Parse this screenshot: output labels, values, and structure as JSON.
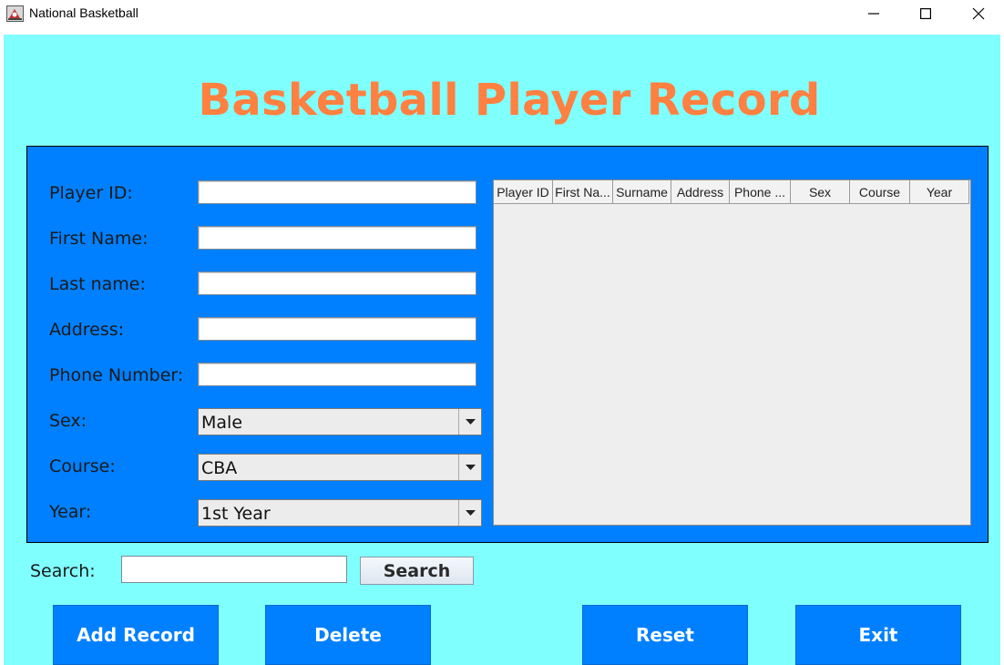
{
  "window": {
    "title": "National Basketball",
    "app_icon": "java-duke-icon",
    "controls": [
      "minimize-icon",
      "maximize-icon",
      "close-icon"
    ]
  },
  "heading": "Basketball Player Record",
  "colors": {
    "frame_bg": "#80ffff",
    "panel_bg": "#0080ff",
    "title": "#ff8040",
    "button_bg": "#0080ff",
    "button_text": "#ffffff"
  },
  "form": {
    "player_id_label": "Player ID:",
    "first_name_label": "First Name:",
    "last_name_label": "Last name:",
    "address_label": "Address:",
    "phone_label": "Phone Number:",
    "sex_label": "Sex:",
    "course_label": "Course:",
    "year_label": "Year:",
    "player_id_value": "",
    "first_name_value": "",
    "last_name_value": "",
    "address_value": "",
    "phone_value": "",
    "sex_value": "Male",
    "course_value": "CBA",
    "year_value": "1st Year"
  },
  "table": {
    "columns": [
      "Player ID",
      "First Na...",
      "Surname",
      "Address",
      "Phone ...",
      "Sex",
      "Course",
      "Year"
    ],
    "rows": []
  },
  "search": {
    "label": "Search:",
    "value": "",
    "button": "Search"
  },
  "actions": {
    "add": "Add Record",
    "delete": "Delete",
    "reset": "Reset",
    "exit": "Exit"
  }
}
